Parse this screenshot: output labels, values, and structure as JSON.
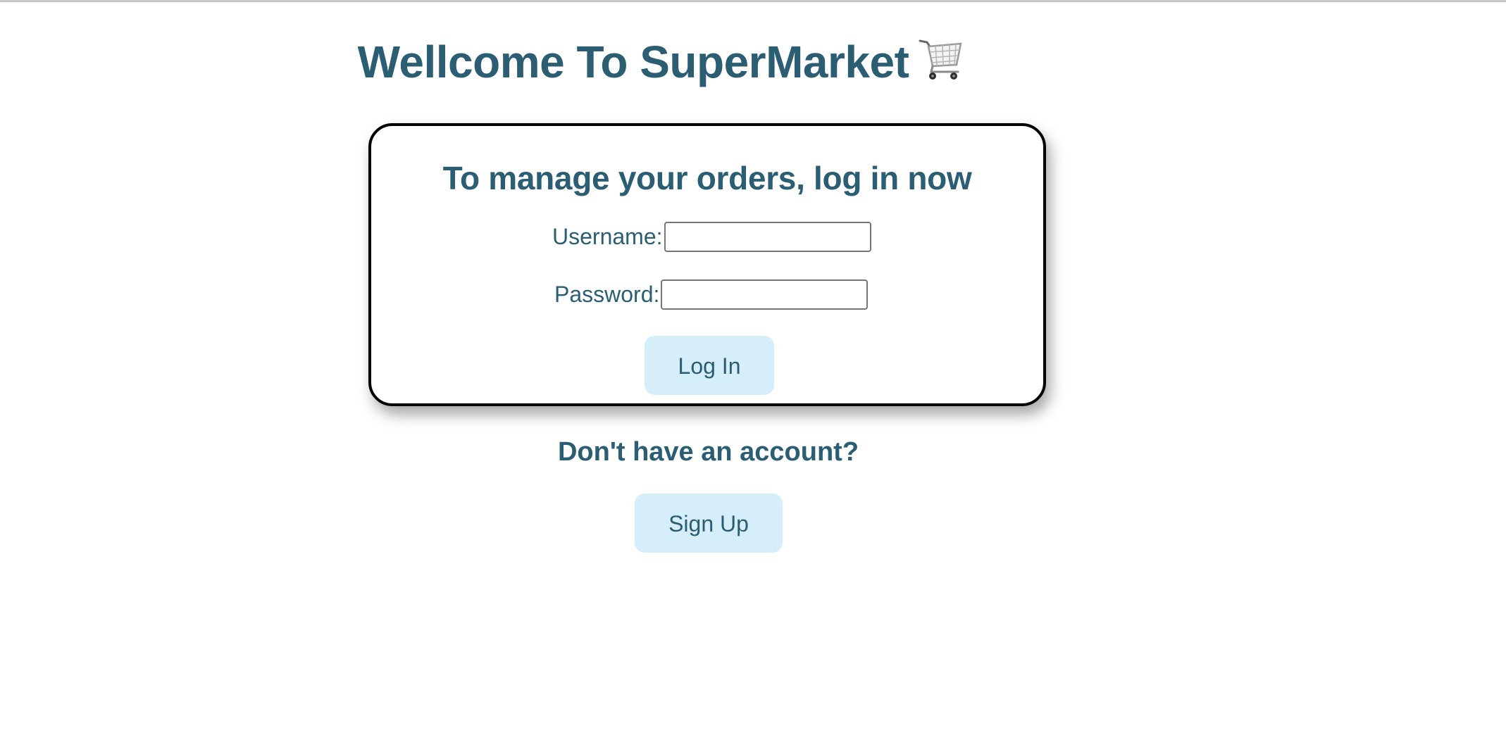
{
  "header": {
    "title": "Wellcome To SuperMarket",
    "icon": "shopping-cart-icon"
  },
  "login_card": {
    "title": "To manage your orders, log in now",
    "username_label": "Username:",
    "username_value": "",
    "password_label": "Password:",
    "password_value": "",
    "login_button_label": "Log In"
  },
  "signup": {
    "prompt": "Don't have an account?",
    "button_label": "Sign Up"
  },
  "colors": {
    "text_primary": "#2b5d73",
    "button_background": "#d6eef9",
    "card_border": "#000000"
  }
}
